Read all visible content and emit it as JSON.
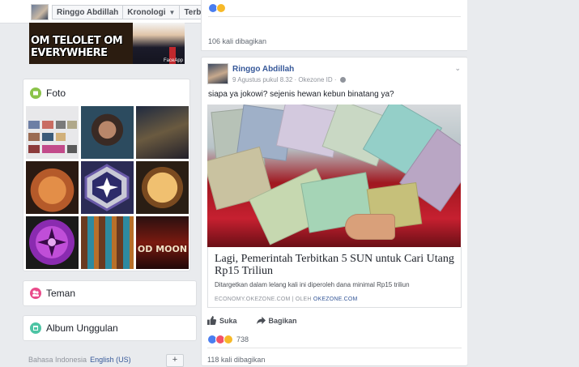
{
  "header": {
    "profile_name": "Ringgo Abdillah",
    "kronologi_label": "Kronologi",
    "terbaru_label": "Terbaru"
  },
  "meme": {
    "text": "OM TELOLET OM EVERYWHERE",
    "watermark": "FaceApp"
  },
  "left": {
    "foto_title": "Foto",
    "teman_title": "Teman",
    "album_title": "Album Unggulan",
    "photo_last_caption": "OD MOON",
    "footer_lang": "Bahasa Indonesia",
    "footer_lang_en": "English (US)",
    "footer_plus": "+"
  },
  "prev_post": {
    "shares": "106 kali dibagikan"
  },
  "post": {
    "author": "Ringgo Abdillah",
    "meta": "9 Agustus pukul 8.32 · Okezone ID ·",
    "text": "siapa ya jokowi? sejenis hewan kebun binatang ya?",
    "link_title": "Lagi, Pemerintah Terbitkan 5 SUN untuk Cari Utang Rp15 Triliun",
    "link_desc": "Ditargetkan dalam lelang kali ini diperoleh dana minimal Rp15 triliun",
    "link_source": "ECONOMY.OKEZONE.COM | OLEH",
    "link_source_by": "OKEZONE.COM",
    "like_label": "Suka",
    "share_label": "Bagikan",
    "reaction_count": "738",
    "shares": "118 kali dibagikan"
  },
  "colors": {
    "link_blue": "#365899",
    "foto_icon": "#8bc34a",
    "teman_icon": "#e94b8a",
    "album_icon": "#4dc4a4"
  }
}
